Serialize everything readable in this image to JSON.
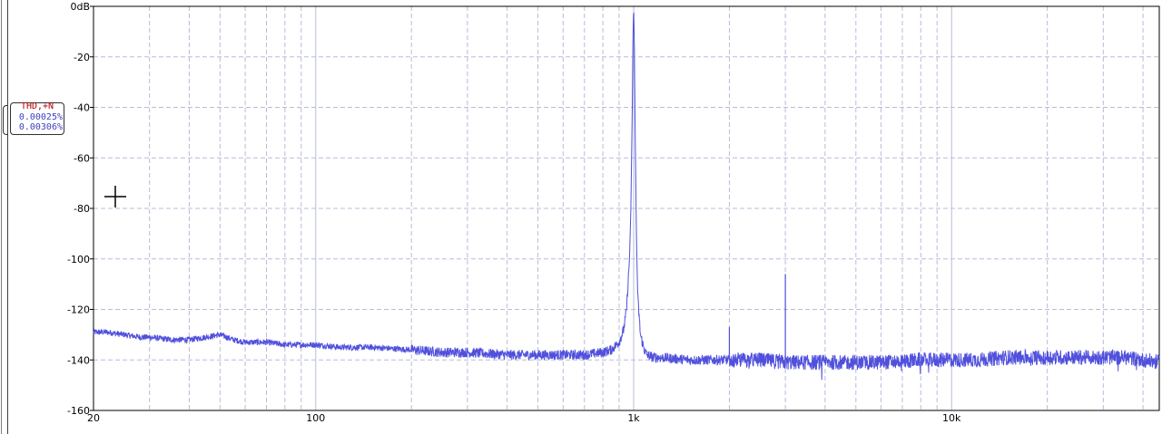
{
  "legend": {
    "title": "THD,+N",
    "values": [
      "0.00025%",
      "0.00306%"
    ]
  },
  "colors": {
    "trace": "#5050dd",
    "grid": "#b8bcd8",
    "frame": "#000000",
    "legend_title": "#b00000",
    "legend_values": "#4040c0"
  },
  "icons": [
    "crosshair-cursor-icon"
  ],
  "chart_data": {
    "type": "line",
    "title": "",
    "xlabel": "",
    "ylabel": "",
    "x_scale": "log",
    "xlim": [
      20,
      45000
    ],
    "ylim": [
      -160,
      0
    ],
    "grid": true,
    "x_tick_labels": [
      {
        "value": 20,
        "label": "20"
      },
      {
        "value": 100,
        "label": "100"
      },
      {
        "value": 1000,
        "label": "1k"
      },
      {
        "value": 10000,
        "label": "10k"
      }
    ],
    "y_tick_labels": [
      {
        "value": 0,
        "label": "0dB"
      },
      {
        "value": -20,
        "label": "-20"
      },
      {
        "value": -40,
        "label": "-40"
      },
      {
        "value": -60,
        "label": "-60"
      },
      {
        "value": -80,
        "label": "-80"
      },
      {
        "value": -100,
        "label": "-100"
      },
      {
        "value": -120,
        "label": "-120"
      },
      {
        "value": -140,
        "label": "-140"
      },
      {
        "value": -160,
        "label": "-160"
      }
    ],
    "series": [
      {
        "x": [
          20,
          22,
          25,
          28,
          30,
          35,
          40,
          45,
          50,
          55,
          60,
          70,
          80,
          100,
          120,
          150,
          200,
          250,
          300,
          400,
          500,
          600,
          700,
          800,
          850,
          900,
          930,
          950,
          970,
          980,
          990,
          995,
          1000,
          1005,
          1010,
          1020,
          1030,
          1050,
          1080,
          1100,
          1150,
          1200,
          1500,
          2000,
          2500,
          3000,
          4000,
          5000,
          6000,
          8000,
          10000,
          12000,
          15000,
          20000,
          25000,
          30000,
          35000,
          40000,
          45000
        ],
        "y": [
          -129,
          -129,
          -130,
          -131,
          -131,
          -132,
          -132,
          -131,
          -130,
          -132,
          -133,
          -133,
          -134,
          -134,
          -135,
          -135,
          -136,
          -137,
          -137,
          -138,
          -138,
          -138,
          -138,
          -137,
          -136,
          -133,
          -128,
          -120,
          -100,
          -80,
          -40,
          -12,
          0,
          -15,
          -45,
          -90,
          -115,
          -130,
          -136,
          -138,
          -139,
          -139,
          -140,
          -140,
          -140,
          -141,
          -141,
          -141,
          -141,
          -140,
          -140,
          -140,
          -139,
          -139,
          -139,
          -139,
          -139,
          -140,
          -141
        ]
      }
    ],
    "spurs": [
      {
        "x": 2000,
        "y": -127
      },
      {
        "x": 3000,
        "y": -106
      }
    ]
  }
}
